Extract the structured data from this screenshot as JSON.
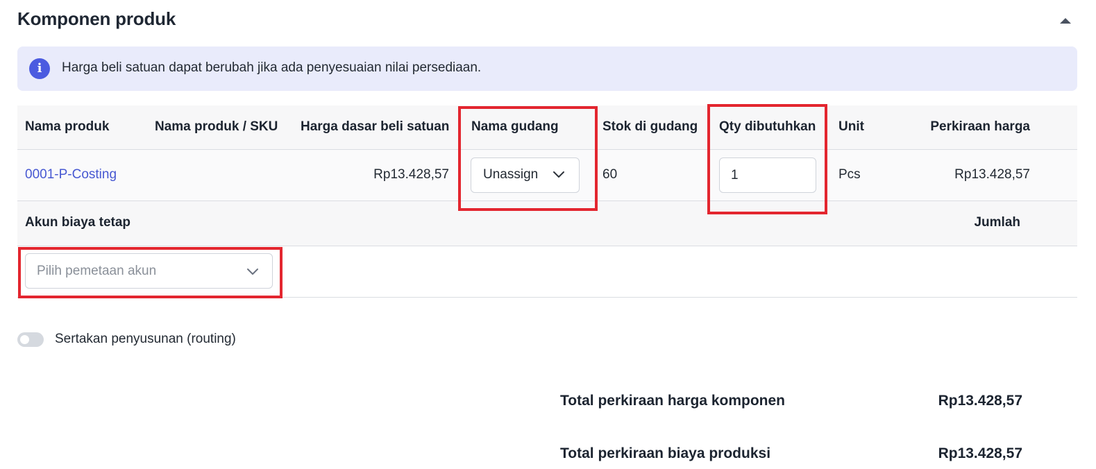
{
  "section": {
    "title": "Komponen produk"
  },
  "info": {
    "text": "Harga beli satuan dapat berubah jika ada penyesuaian nilai persediaan."
  },
  "table": {
    "columns": [
      "Nama produk",
      "Nama produk / SKU",
      "Harga dasar beli satuan",
      "Nama gudang",
      "Stok di gudang",
      "Qty dibutuhkan",
      "Unit",
      "Perkiraan harga"
    ],
    "row": {
      "product_code": "0001-P-Costing",
      "sku": "",
      "base_price": "Rp13.428,57",
      "warehouse": "Unassigned",
      "stock": "60",
      "qty": "1",
      "unit": "Pcs",
      "estimated_price": "Rp13.428,57"
    }
  },
  "fixed_cost": {
    "header_account": "Akun biaya tetap",
    "header_amount": "Jumlah",
    "account_placeholder": "Pilih pemetaan akun"
  },
  "routing": {
    "label": "Sertakan penyusunan (routing)",
    "enabled": false
  },
  "totals": {
    "component_label": "Total perkiraan harga komponen",
    "component_value": "Rp13.428,57",
    "production_label": "Total perkiraan biaya produksi",
    "production_value": "Rp13.428,57"
  },
  "colors": {
    "accent": "#4b5be0",
    "link": "#4758d2",
    "highlight": "#e3262f",
    "banner_bg": "#e9ebfb"
  }
}
